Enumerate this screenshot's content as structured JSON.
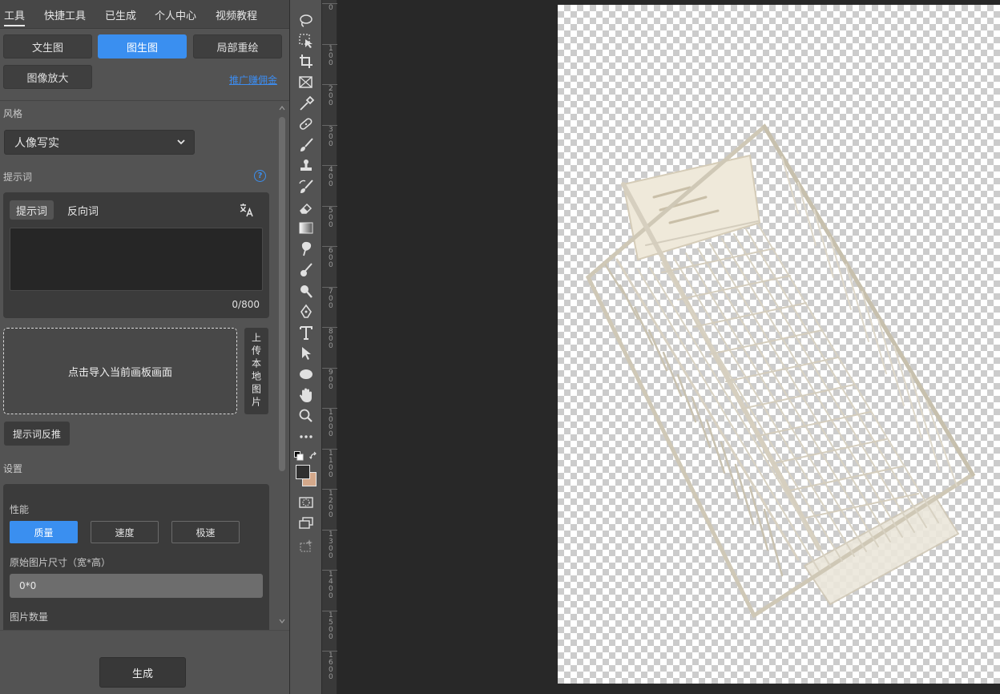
{
  "menu": [
    "工具",
    "快捷工具",
    "已生成",
    "个人中心",
    "视频教程"
  ],
  "modes": {
    "txt2img": "文生图",
    "img2img": "图生图",
    "inpaint": "局部重绘",
    "upscale": "图像放大",
    "promo": "推广赚佣金"
  },
  "style": {
    "label": "风格",
    "selected": "人像写实"
  },
  "prompt": {
    "label": "提示词",
    "tab_positive": "提示词",
    "tab_negative": "反向词",
    "value": "",
    "counter": "0/800"
  },
  "import": {
    "drop_text": "点击导入当前画板画面",
    "upload_text": "上传本地图片",
    "reverse_btn": "提示词反推"
  },
  "settings": {
    "label": "设置",
    "perf_label": "性能",
    "perf_options": [
      "质量",
      "速度",
      "极速"
    ],
    "perf_selected": "质量",
    "size_label": "原始图片尺寸（宽*高）",
    "size_value": "0*0",
    "count_label": "图片数量"
  },
  "generate_label": "生成",
  "ruler_labels": [
    "0",
    "100",
    "200",
    "300",
    "400",
    "500",
    "600",
    "700",
    "800",
    "900",
    "1000",
    "1100",
    "1200",
    "1300",
    "1400",
    "1500",
    "1600"
  ],
  "colors": {
    "accent": "#3a8ff0",
    "foreground_swatch": "#303030",
    "background_swatch": "#d4a88a"
  },
  "tool_icons": [
    "lasso-icon",
    "object-select-icon",
    "crop-icon",
    "frame-icon",
    "eyedropper-icon",
    "healing-icon",
    "brush-icon",
    "stamp-icon",
    "history-brush-icon",
    "eraser-icon",
    "gradient-icon",
    "smudge-icon",
    "dodge-icon",
    "burn-icon",
    "pen-icon",
    "type-icon",
    "path-select-icon",
    "ellipse-icon",
    "hand-icon",
    "zoom-icon",
    "more-icon"
  ]
}
